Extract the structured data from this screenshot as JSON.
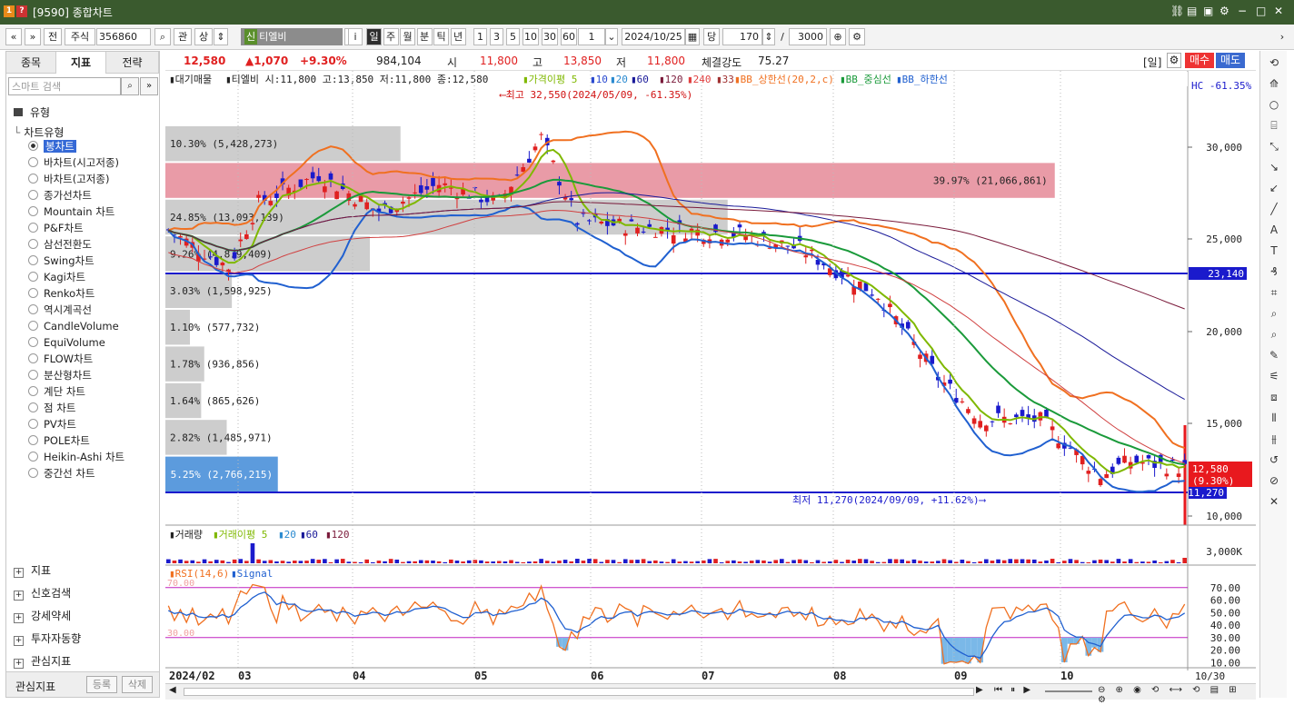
{
  "window": {
    "title": "[9590] 종합차트"
  },
  "toolbar": {
    "nav_prev": "«",
    "nav_down": "»",
    "all": "전",
    "market": "주식",
    "code": "356860",
    "search_icon": "🔍",
    "gwan": "관",
    "sang": "상",
    "stock_mark": "신",
    "stock_name": "티엘비",
    "info_btn": "i",
    "periods": [
      "일",
      "주",
      "월",
      "분",
      "틱",
      "년"
    ],
    "minutes": [
      "1",
      "3",
      "5",
      "10",
      "30",
      "60"
    ],
    "count_select": "1",
    "date": "2024/10/25",
    "dang": "당",
    "bars": "170",
    "slash": "/",
    "total": "3000",
    "more": "›"
  },
  "left_panel": {
    "tabs": [
      "종목",
      "지표",
      "전략"
    ],
    "active_tab": 1,
    "search_placeholder": "스마트 검색",
    "tree_root": "유형",
    "tree_sub": "차트유형",
    "chart_types": [
      "봉차트",
      "바차트(시고저종)",
      "바차트(고저종)",
      "종가선차트",
      "Mountain 차트",
      "P&F차트",
      "삼선전환도",
      "Swing차트",
      "Kagi차트",
      "Renko차트",
      "역시계곡선",
      "CandleVolume",
      "EquiVolume",
      "FLOW차트",
      "분산형차트",
      "계단 차트",
      "점 차트",
      "PV차트",
      "POLE차트",
      "Heikin-Ashi 차트",
      "중간선 차트"
    ],
    "selected_type": 0,
    "sections": [
      "지표",
      "신호검색",
      "강세약세",
      "투자자동향",
      "관심지표"
    ],
    "footer_label": "관심지표",
    "register": "등록",
    "delete": "삭제"
  },
  "quote": {
    "price": "12,580",
    "change": "▲1,070",
    "change_pct": "+9.30%",
    "volume": "984,104",
    "open_label": "시",
    "open": "11,800",
    "high_label": "고",
    "high": "13,850",
    "low_label": "저",
    "low": "11,800",
    "strength_label": "체결강도",
    "strength": "75.27",
    "period_tag": "[일]",
    "buy": "매수",
    "sell": "매도"
  },
  "main_chart": {
    "legend": {
      "a": "▮대기매물",
      "b": "▮티엘비 시:11,800 고:13,850 저:11,800 종:12,580",
      "ma": "▮가격이평 5",
      "ma10": "▮10",
      "ma20": "▮20",
      "ma60": "▮60",
      "ma120": "▮120",
      "ma240": "▮240",
      "ma33": "▮33",
      "bbu": "▮BB_상한선(20,2,c)",
      "bbm": "▮BB_중심선",
      "bbl": "▮BB_하한선"
    },
    "hc": "HC -61.35%",
    "high_note": "⟵최고 32,550(2024/05/09, -61.35%)",
    "low_note": "최저 11,270(2024/09/09, +11.62%)⟶",
    "price_ticks": [
      "30,000",
      "25,000",
      "20,000",
      "15,000",
      "10,000"
    ],
    "line_23140": "23,140",
    "line_11270": "11,270",
    "last_price": "12,580",
    "last_pct": "(9.30%)",
    "profile": [
      {
        "label": "10.30% (5,428,273)",
        "width": 0.23
      },
      {
        "label": "39.97% (21,066,861)",
        "width": 0.87
      },
      {
        "label": "24.85% (13,093,139)",
        "width": 0.55
      },
      {
        "label": "9.26% (4,879,409)",
        "width": 0.2
      },
      {
        "label": "3.03% (1,598,925)",
        "width": 0.065
      },
      {
        "label": "1.10% (577,732)",
        "width": 0.024
      },
      {
        "label": "1.78% (936,856)",
        "width": 0.038
      },
      {
        "label": "1.64% (865,626)",
        "width": 0.035
      },
      {
        "label": "2.82% (1,485,971)",
        "width": 0.06
      },
      {
        "label": "5.25% (2,766,215)",
        "width": 0.11
      }
    ]
  },
  "volume_chart": {
    "legend_a": "▮거래량",
    "legend_b": "▮거래이평 5",
    "l20": "▮20",
    "l60": "▮60",
    "l120": "▮120",
    "tick": "3,000K"
  },
  "rsi_chart": {
    "legend_a": "▮RSI(14,6)",
    "legend_b": "▮Signal",
    "upper": "70.00",
    "lower": "30.00",
    "ticks": [
      "70.00",
      "60.00",
      "50.00",
      "40.00",
      "30.00",
      "20.00",
      "10.00"
    ]
  },
  "x_axis": {
    "labels": [
      "2024/02",
      "03",
      "04",
      "05",
      "06",
      "07",
      "08",
      "09",
      "10"
    ],
    "last": "10/30"
  },
  "colors": {
    "up": "#e02020",
    "down": "#1a1acc",
    "ma5": "#7fb800",
    "ma20": "#1a9a3a",
    "bb": "#f07020",
    "bb_lower": "#2060d0"
  }
}
